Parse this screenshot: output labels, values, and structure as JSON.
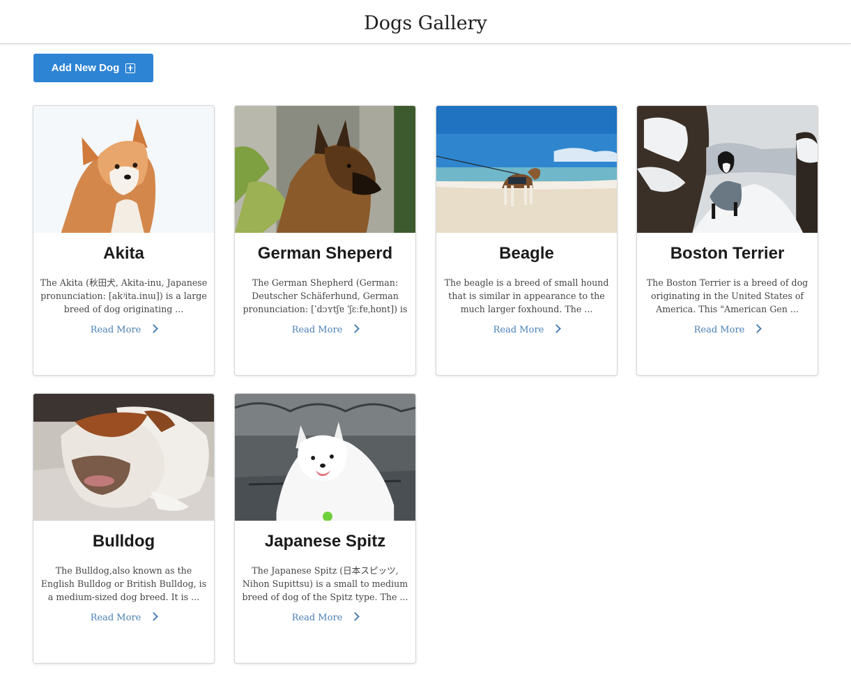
{
  "header": {
    "title": "Dogs Gallery"
  },
  "toolbar": {
    "add_label": "Add New Dog",
    "add_icon": "plus-square-icon"
  },
  "colors": {
    "accent": "#2d84d4",
    "link": "#4a7fb5"
  },
  "dogs": [
    {
      "name": "Akita",
      "description": "The Akita (秋田犬, Akita-inu, Japanese pronunciation: [akʲita.inɯ]) is a large breed of dog originating ...",
      "link_label": "Read More"
    },
    {
      "name": "German Sheperd",
      "description": "The German Shepherd (German: Deutscher Schäferhund, German pronunciation: [ˈdɔʏtʃɐ ˈʃɛːfɐˌhʊnt]) is ...",
      "link_label": "Read More"
    },
    {
      "name": "Beagle",
      "description": "The beagle is a breed of small hound that is similar in appearance to the much larger foxhound. The ...",
      "link_label": "Read More"
    },
    {
      "name": "Boston Terrier",
      "description": "The Boston Terrier is a breed of dog originating in the United States of America. This \"American Gen ...",
      "link_label": "Read More"
    },
    {
      "name": "Bulldog",
      "description": "The Bulldog,also known as the English Bulldog or British Bulldog, is a medium-sized dog breed. It is ...",
      "link_label": "Read More"
    },
    {
      "name": "Japanese Spitz",
      "description": "The Japanese Spitz (日本スピッツ, Nihon Supittsu) is a small to medium breed of dog of the Spitz type. The ...",
      "link_label": "Read More"
    }
  ]
}
